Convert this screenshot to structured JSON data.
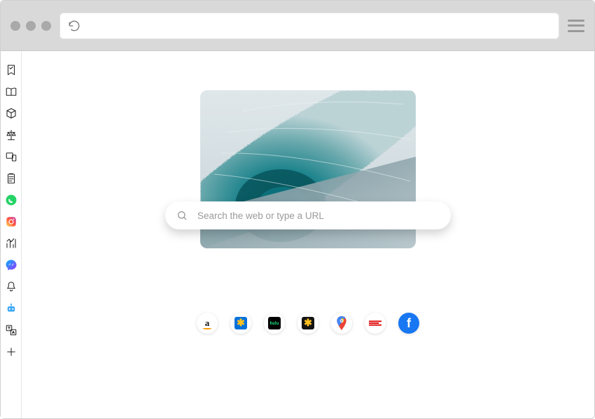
{
  "address_bar": {
    "value": ""
  },
  "search": {
    "placeholder": "Search the web or type a URL",
    "value": ""
  },
  "sidebar": {
    "items": [
      {
        "name": "bookmark-icon"
      },
      {
        "name": "library-icon"
      },
      {
        "name": "package-icon"
      },
      {
        "name": "scale-icon"
      },
      {
        "name": "devices-icon"
      },
      {
        "name": "clipboard-icon"
      },
      {
        "name": "whatsapp-icon"
      },
      {
        "name": "instagram-icon"
      },
      {
        "name": "stats-icon"
      },
      {
        "name": "messenger-icon"
      },
      {
        "name": "bell-icon"
      },
      {
        "name": "bot-icon"
      },
      {
        "name": "translate-icon"
      },
      {
        "name": "add-icon"
      }
    ]
  },
  "hero_image": {
    "alt": "Ocean wave"
  },
  "shortcuts": [
    {
      "name": "amazon",
      "bg": "#fff",
      "letter": "a",
      "color": "#111",
      "accent": "#FF9900"
    },
    {
      "name": "walmart",
      "bg": "#0071dc",
      "letter": "✱",
      "color": "#ffc220"
    },
    {
      "name": "hulu",
      "bg": "#000",
      "letter": "hulu",
      "color": "#1ce783"
    },
    {
      "name": "walmart-alt",
      "bg": "#131313",
      "letter": "✱",
      "color": "#ffc220"
    },
    {
      "name": "google-maps",
      "bg": "#fff",
      "letter": "",
      "color": ""
    },
    {
      "name": "espn",
      "bg": "#fff",
      "letter": "E",
      "color": "#d00"
    },
    {
      "name": "facebook",
      "bg": "#1877f2",
      "letter": "f",
      "color": "#fff"
    }
  ]
}
